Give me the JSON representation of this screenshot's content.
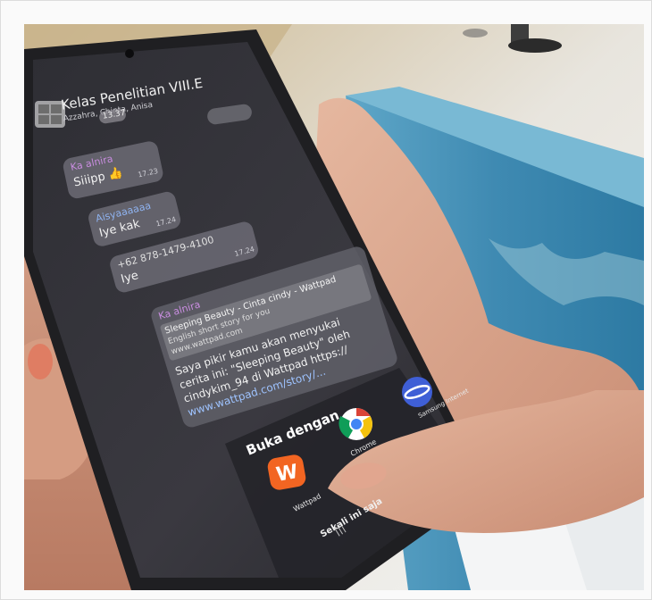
{
  "chat": {
    "title": "Kelas Penelitian VIII.E",
    "subtitle": "Azzahra, Chinta, Anisa",
    "date_badge": "13.37",
    "messages": [
      {
        "sender": "Ka alnira",
        "text": "Siiipp 👍",
        "time": "17.23"
      },
      {
        "sender": "Aisyaaaaaa",
        "text": "Iye kak",
        "time": "17.24"
      },
      {
        "sender": "+62 878-1479-4100",
        "text": "Iye",
        "time": "17.24"
      }
    ],
    "shared": {
      "sender": "Ka alnira",
      "link_title": "Sleeping Beauty - Cinta cindy - Wattpad",
      "link_desc": "English short story for you",
      "link_domain": "www.wattpad.com",
      "body": [
        "Saya pikir kamu akan menyukai",
        "cerita ini: \"Sleeping Beauty\" oleh",
        "cindykim_94 di Wattpad https://",
        "www.wattpad.com/story/..."
      ]
    }
  },
  "sheet": {
    "title": "Buka dengan",
    "apps": [
      {
        "label": "Wattpad"
      },
      {
        "label": "Chrome"
      },
      {
        "label": "Samsung Internet"
      }
    ],
    "once_label": "Sekali ini saja"
  },
  "colors": {
    "background": "#d8d2c6",
    "table_blue": "#3a87b0",
    "phone_body": "#1f1f22",
    "bubble": "#6e6c76",
    "wattpad": "#f26522"
  }
}
